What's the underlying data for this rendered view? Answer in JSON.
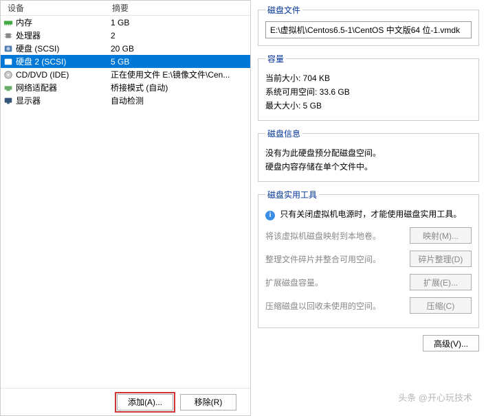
{
  "headers": {
    "device": "设备",
    "summary": "摘要"
  },
  "devices": [
    {
      "icon": "memory-icon",
      "label": "内存",
      "summary": "1 GB"
    },
    {
      "icon": "cpu-icon",
      "label": "处理器",
      "summary": "2"
    },
    {
      "icon": "disk-icon",
      "label": "硬盘 (SCSI)",
      "summary": "20 GB"
    },
    {
      "icon": "disk-icon",
      "label": "硬盘 2 (SCSI)",
      "summary": "5 GB",
      "selected": true
    },
    {
      "icon": "cd-icon",
      "label": "CD/DVD (IDE)",
      "summary": "正在使用文件 E:\\镜像文件\\Cen..."
    },
    {
      "icon": "nic-icon",
      "label": "网络适配器",
      "summary": "桥接模式 (自动)"
    },
    {
      "icon": "monitor-icon",
      "label": "显示器",
      "summary": "自动检测"
    }
  ],
  "buttons": {
    "add": "添加(A)...",
    "remove": "移除(R)"
  },
  "disk_file": {
    "legend": "磁盘文件",
    "path": "E:\\虚拟机\\Centos6.5-1\\CentOS 中文版64 位-1.vmdk"
  },
  "capacity": {
    "legend": "容量",
    "current": "当前大小: 704 KB",
    "free": "系统可用空间: 33.6 GB",
    "max": "最大大小: 5 GB"
  },
  "disk_info": {
    "legend": "磁盘信息",
    "line1": "没有为此硬盘预分配磁盘空间。",
    "line2": "硬盘内容存储在单个文件中。"
  },
  "utilities": {
    "legend": "磁盘实用工具",
    "tip": "只有关闭虚拟机电源时，才能使用磁盘实用工具。",
    "rows": [
      {
        "desc": "将该虚拟机磁盘映射到本地卷。",
        "label": "映射(M)..."
      },
      {
        "desc": "整理文件碎片并整合可用空间。",
        "label": "碎片整理(D)"
      },
      {
        "desc": "扩展磁盘容量。",
        "label": "扩展(E)..."
      },
      {
        "desc": "压缩磁盘以回收未使用的空间。",
        "label": "压缩(C)"
      }
    ]
  },
  "advanced": {
    "label": "高级(V)..."
  },
  "watermark": "头条 @开心玩技术"
}
